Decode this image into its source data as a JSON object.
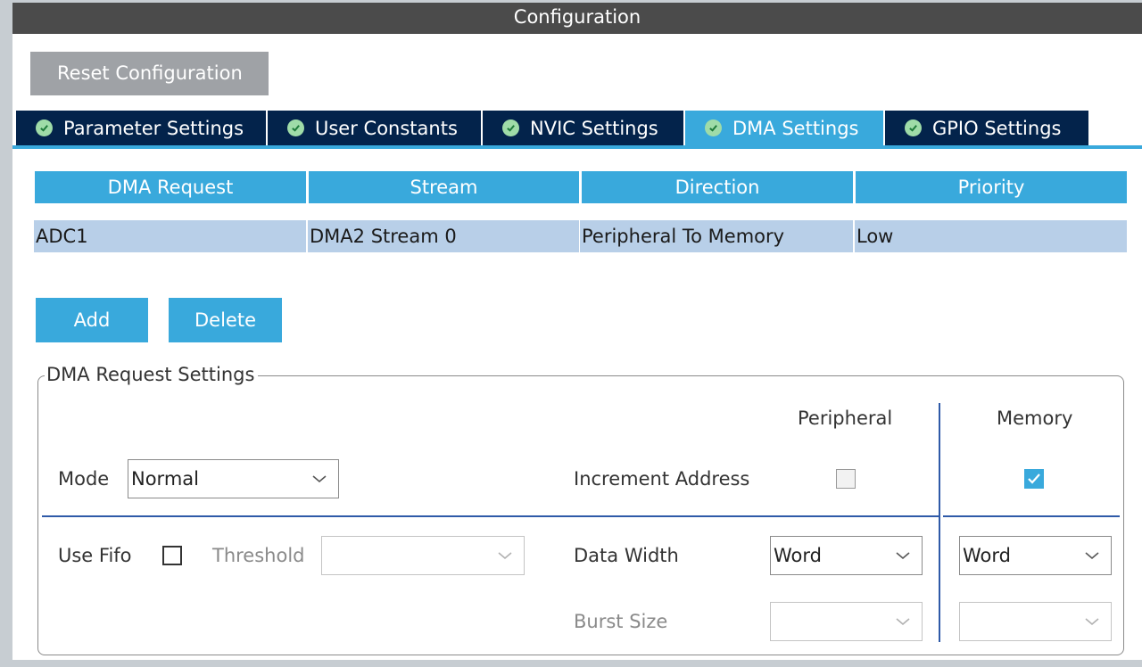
{
  "window": {
    "title": "Configuration"
  },
  "toolbar": {
    "reset_label": "Reset Configuration"
  },
  "tabs": [
    {
      "label": "Parameter Settings",
      "active": false
    },
    {
      "label": "User Constants",
      "active": false
    },
    {
      "label": "NVIC Settings",
      "active": false
    },
    {
      "label": "DMA Settings",
      "active": true
    },
    {
      "label": "GPIO Settings",
      "active": false
    }
  ],
  "dma_table": {
    "columns": [
      "DMA Request",
      "Stream",
      "Direction",
      "Priority"
    ],
    "rows": [
      [
        "ADC1",
        "DMA2 Stream 0",
        "Peripheral To Memory",
        "Low"
      ]
    ]
  },
  "actions": {
    "add_label": "Add",
    "delete_label": "Delete"
  },
  "request_settings": {
    "legend": "DMA Request Settings",
    "peripheral_header": "Peripheral",
    "memory_header": "Memory",
    "mode_label": "Mode",
    "mode_value": "Normal",
    "increment_label": "Increment Address",
    "peripheral_increment": false,
    "memory_increment": true,
    "use_fifo_label": "Use Fifo",
    "use_fifo": false,
    "threshold_label": "Threshold",
    "threshold_value": "",
    "data_width_label": "Data Width",
    "peripheral_data_width": "Word",
    "memory_data_width": "Word",
    "burst_size_label": "Burst Size",
    "peripheral_burst": "",
    "memory_burst": ""
  },
  "colors": {
    "accent": "#39a9dc",
    "tab_dark": "#03234b",
    "title_bar": "#4b4b4b",
    "row_selected": "#b8cfe8"
  }
}
